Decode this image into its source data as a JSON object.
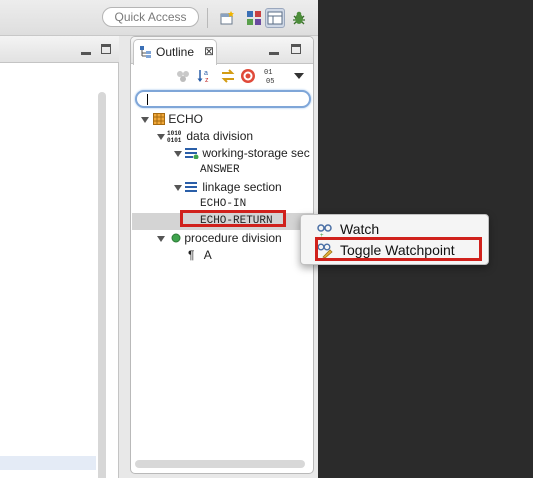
{
  "toolbar": {
    "quick_access_label": "Quick Access"
  },
  "outline": {
    "tab_label": "Outline",
    "close_glyph": "⊠",
    "tree": {
      "program": "ECHO",
      "data_division": "data division",
      "working_storage": "working-storage sec",
      "answer": "ANSWER",
      "linkage": "linkage section",
      "echo_in": "ECHO-IN",
      "echo_return": "ECHO-RETURN",
      "procedure_division": "procedure division",
      "para_mark": "¶",
      "paragraph_a": "A"
    },
    "binary_icon_text": [
      "1010",
      "0101"
    ],
    "sort_icon_text": [
      "a",
      "z"
    ],
    "numbers_icon_text": [
      "01",
      "05"
    ]
  },
  "context_menu": {
    "items": [
      {
        "label": "Watch",
        "icon": "watch-icon"
      },
      {
        "label": "Toggle Watchpoint",
        "icon": "watchpoint-icon"
      }
    ]
  },
  "colors": {
    "highlight": "#d0211c",
    "dark_editor": "#2b2b2b",
    "selection": "#d4d4d4"
  }
}
